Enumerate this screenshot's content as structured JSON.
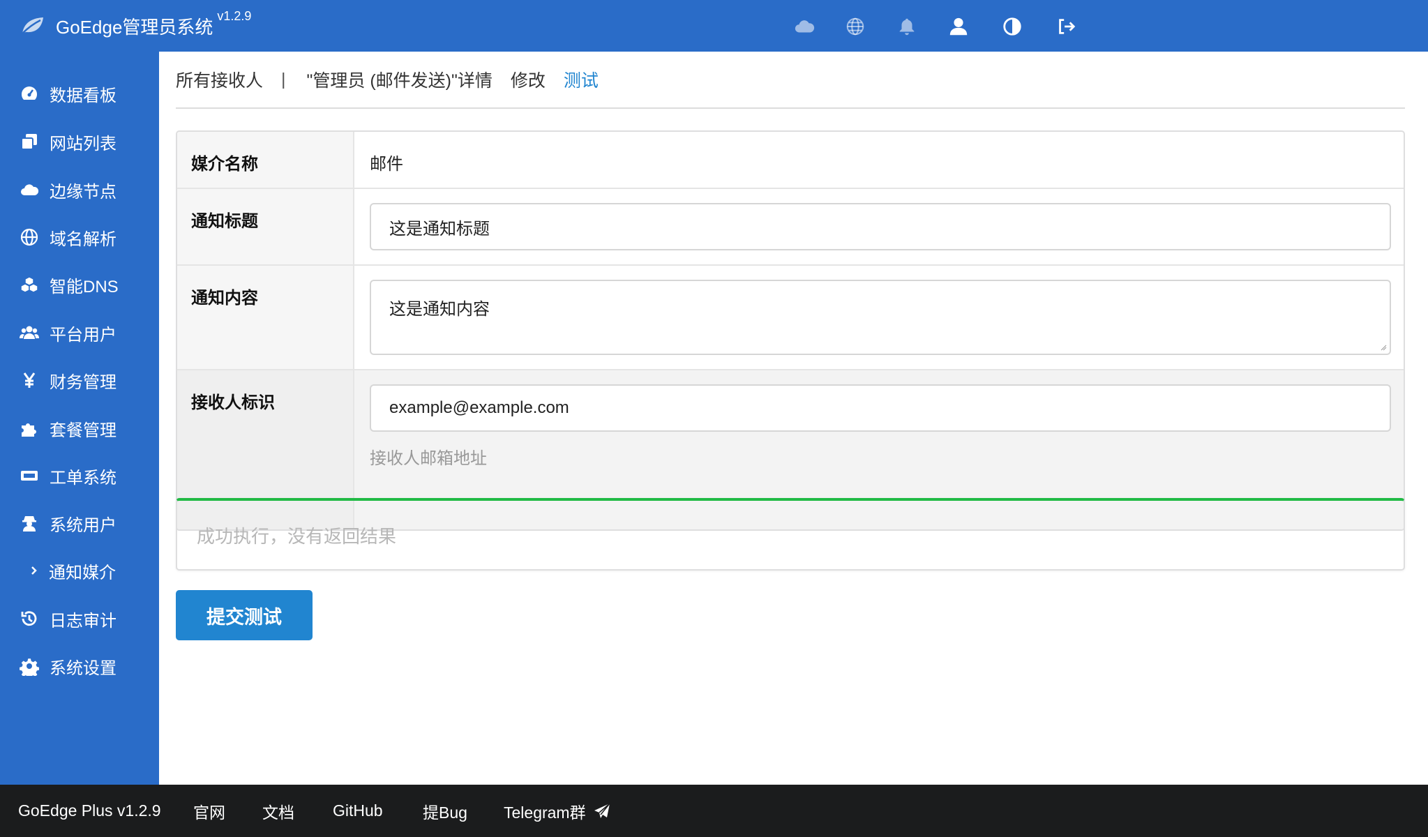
{
  "header": {
    "app_name": "GoEdge管理员系统",
    "version": "v1.2.9",
    "icons": [
      "cloud-icon",
      "globe-icon",
      "bell-icon",
      "user-icon",
      "theme-contrast-icon",
      "logout-icon"
    ]
  },
  "sidebar": {
    "items": [
      {
        "label": "数据看板",
        "icon": "dashboard-icon"
      },
      {
        "label": "网站列表",
        "icon": "clone-icon"
      },
      {
        "label": "边缘节点",
        "icon": "cloud-icon"
      },
      {
        "label": "域名解析",
        "icon": "globe-icon"
      },
      {
        "label": "智能DNS",
        "icon": "cubes-icon"
      },
      {
        "label": "平台用户",
        "icon": "users-icon"
      },
      {
        "label": "财务管理",
        "icon": "yen-icon"
      },
      {
        "label": "套餐管理",
        "icon": "puzzle-icon"
      },
      {
        "label": "工单系统",
        "icon": "ticket-icon"
      },
      {
        "label": "系统用户",
        "icon": "user-secret-icon"
      },
      {
        "label": "通知媒介",
        "icon": "chevron-right-icon"
      },
      {
        "label": "日志审计",
        "icon": "history-icon"
      },
      {
        "label": "系统设置",
        "icon": "gear-icon"
      }
    ]
  },
  "tabs": {
    "all_receivers": "所有接收人",
    "separator": "|",
    "detail": "\"管理员 (邮件发送)\"详情",
    "edit": "修改",
    "test": "测试"
  },
  "form": {
    "media_name_label": "媒介名称",
    "media_name_value": "邮件",
    "subject_label": "通知标题",
    "subject_value": "这是通知标题",
    "body_label": "通知内容",
    "body_value": "这是通知内容",
    "receiver_label": "接收人标识",
    "receiver_value": "example@example.com",
    "receiver_hint": "接收人邮箱地址"
  },
  "result": {
    "message": "成功执行，没有返回结果"
  },
  "submit_label": "提交测试",
  "footer": {
    "product": "GoEdge Plus v1.2.9",
    "links": [
      "官网",
      "文档",
      "GitHub",
      "提Bug",
      "Telegram群"
    ]
  },
  "colors": {
    "primary": "#2a6cc8",
    "accent": "#2185d0",
    "success": "#21ba45",
    "footer": "#1b1c1d"
  }
}
